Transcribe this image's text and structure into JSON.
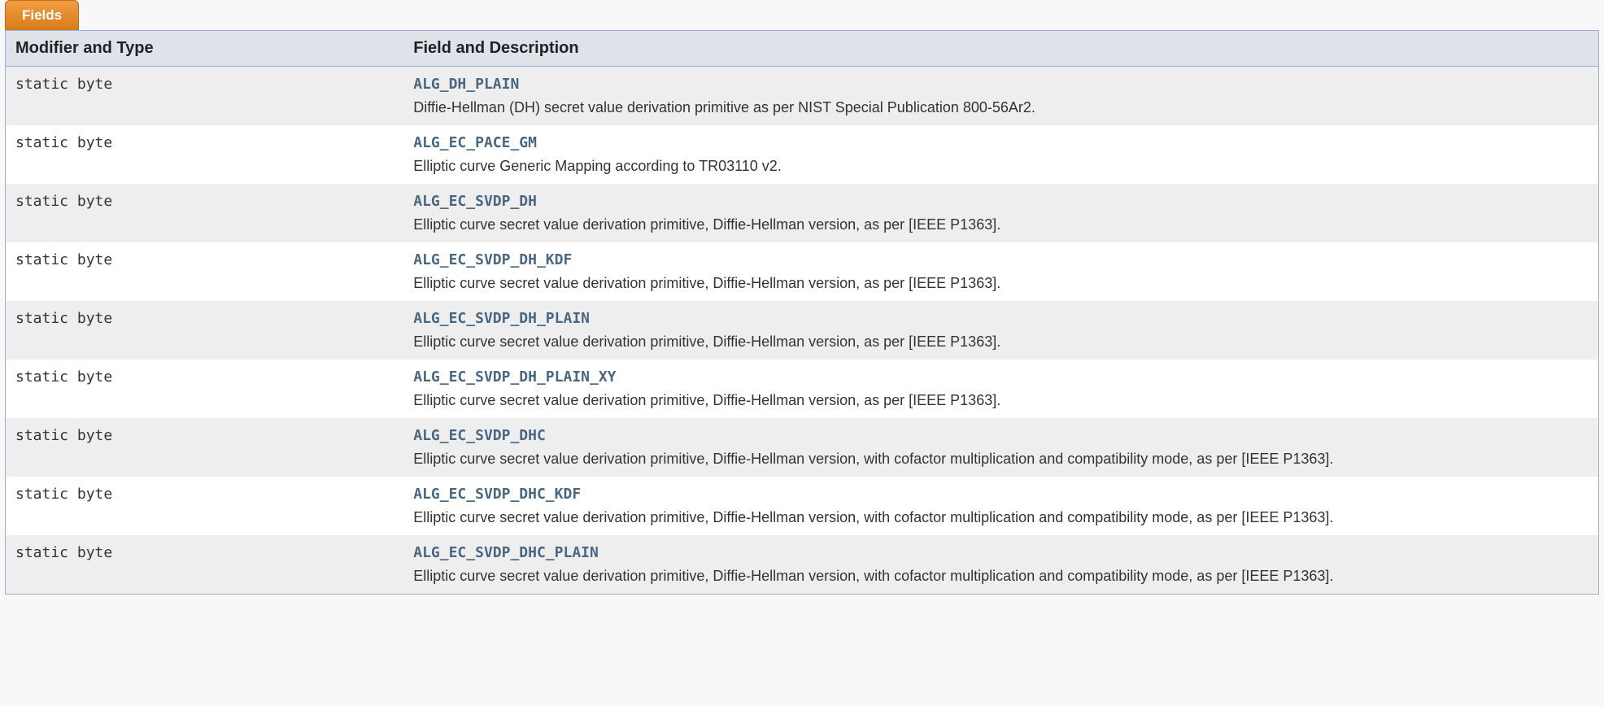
{
  "tab_label": "Fields",
  "headers": {
    "modifier": "Modifier and Type",
    "description": "Field and Description"
  },
  "rows": [
    {
      "type": "static byte",
      "name": "ALG_DH_PLAIN",
      "desc": "Diffie-Hellman (DH) secret value derivation primitive as per NIST Special Publication 800-56Ar2."
    },
    {
      "type": "static byte",
      "name": "ALG_EC_PACE_GM",
      "desc": "Elliptic curve Generic Mapping according to TR03110 v2."
    },
    {
      "type": "static byte",
      "name": "ALG_EC_SVDP_DH",
      "desc": "Elliptic curve secret value derivation primitive, Diffie-Hellman version, as per [IEEE P1363]."
    },
    {
      "type": "static byte",
      "name": "ALG_EC_SVDP_DH_KDF",
      "desc": "Elliptic curve secret value derivation primitive, Diffie-Hellman version, as per [IEEE P1363]."
    },
    {
      "type": "static byte",
      "name": "ALG_EC_SVDP_DH_PLAIN",
      "desc": "Elliptic curve secret value derivation primitive, Diffie-Hellman version, as per [IEEE P1363]."
    },
    {
      "type": "static byte",
      "name": "ALG_EC_SVDP_DH_PLAIN_XY",
      "desc": "Elliptic curve secret value derivation primitive, Diffie-Hellman version, as per [IEEE P1363]."
    },
    {
      "type": "static byte",
      "name": "ALG_EC_SVDP_DHC",
      "desc": "Elliptic curve secret value derivation primitive, Diffie-Hellman version, with cofactor multiplication and compatibility mode, as per [IEEE P1363]."
    },
    {
      "type": "static byte",
      "name": "ALG_EC_SVDP_DHC_KDF",
      "desc": "Elliptic curve secret value derivation primitive, Diffie-Hellman version, with cofactor multiplication and compatibility mode, as per [IEEE P1363]."
    },
    {
      "type": "static byte",
      "name": "ALG_EC_SVDP_DHC_PLAIN",
      "desc": "Elliptic curve secret value derivation primitive, Diffie-Hellman version, with cofactor multiplication and compatibility mode, as per [IEEE P1363]."
    }
  ]
}
